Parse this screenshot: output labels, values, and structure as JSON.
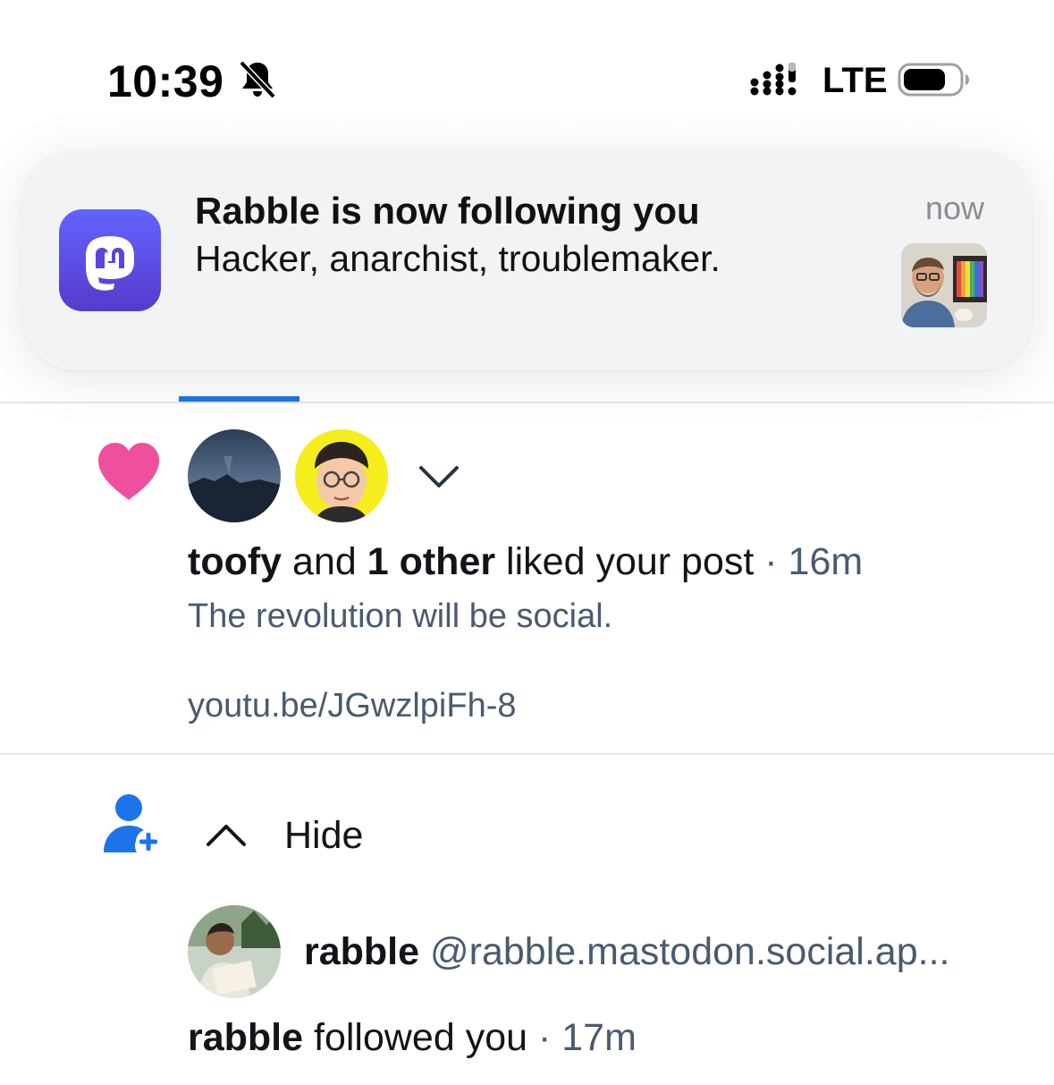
{
  "status_bar": {
    "time": "10:39",
    "network": "LTE",
    "icons": [
      "bell-slash-icon",
      "signal-icon",
      "battery-icon"
    ]
  },
  "banner": {
    "title": "Rabble is now following you",
    "body": "Hacker, anarchist, troublemaker.",
    "time": "now",
    "app_icon": "mastodon-icon",
    "accent_color": "#6364ff"
  },
  "like_notification": {
    "icon": "heart-icon",
    "icon_color": "#ef4f9f",
    "actor": "toofy",
    "connector": " and ",
    "others": "1 other",
    "action": " liked your post",
    "time": " · 16m",
    "post_text": "The revolution will be social.",
    "post_link": "youtu.be/JGwzlpiFh-8"
  },
  "follow_notification": {
    "icon": "person-add-icon",
    "icon_color": "#1d74e8",
    "toggle_label": "Hide",
    "account_name": "rabble",
    "account_handle": "@rabble.mastodon.social.ap...",
    "actor": "rabble",
    "action": " followed you",
    "time": " · 17m"
  },
  "colors": {
    "tab_indicator": "#1d74e8",
    "muted_text": "#4a5a70"
  }
}
